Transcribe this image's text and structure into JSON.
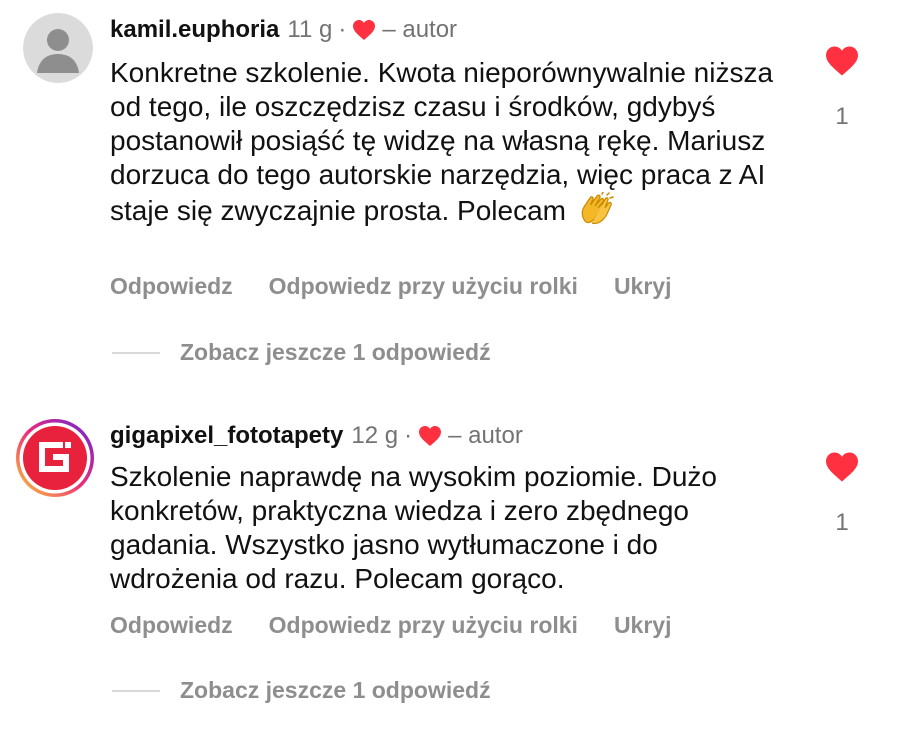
{
  "comments": [
    {
      "username": "kamil.euphoria",
      "time": "11 g",
      "dot": "·",
      "author_label": "– autor",
      "text": "Konkretne szkolenie. Kwota nieporównywalnie niższa od tego, ile oszczędzisz czasu i środków, gdybyś postanowił posiąść tę widzę na własną rękę. Mariusz dorzuca do tego autorskie narzędzia, więc praca z AI staje się zwyczajnie prosta. Polecam",
      "emoji": "clapping-hands-icon",
      "likes": "1",
      "actions": [
        "Odpowiedz",
        "Odpowiedz przy użyciu rolki",
        "Ukryj"
      ],
      "view_replies": "Zobacz jeszcze 1 odpowiedź",
      "avatar": "default-profile-icon"
    },
    {
      "username": "gigapixel_fototapety",
      "time": "12 g",
      "dot": "·",
      "author_label": "– autor",
      "text": "Szkolenie naprawdę na wysokim poziomie. Dużo konkretów, praktyczna wiedza i zero zbędnego gadania. Wszystko jasno wytłumaczone i do wdrożenia od razu. Polecam gorąco.",
      "likes": "1",
      "actions": [
        "Odpowiedz",
        "Odpowiedz przy użyciu rolki",
        "Ukryj"
      ],
      "view_replies": "Zobacz jeszcze 1 odpowiedź",
      "avatar": "gigapixel-logo-icon"
    }
  ],
  "colors": {
    "heart": "#ff3040",
    "secondary_text": "#737373",
    "action_text": "#8e8e8e",
    "avatar_gradient_start": "#f9ce34",
    "avatar_gradient_mid": "#ee2a7b",
    "avatar_gradient_end": "#6228d7",
    "logo_red": "#e8213c"
  }
}
